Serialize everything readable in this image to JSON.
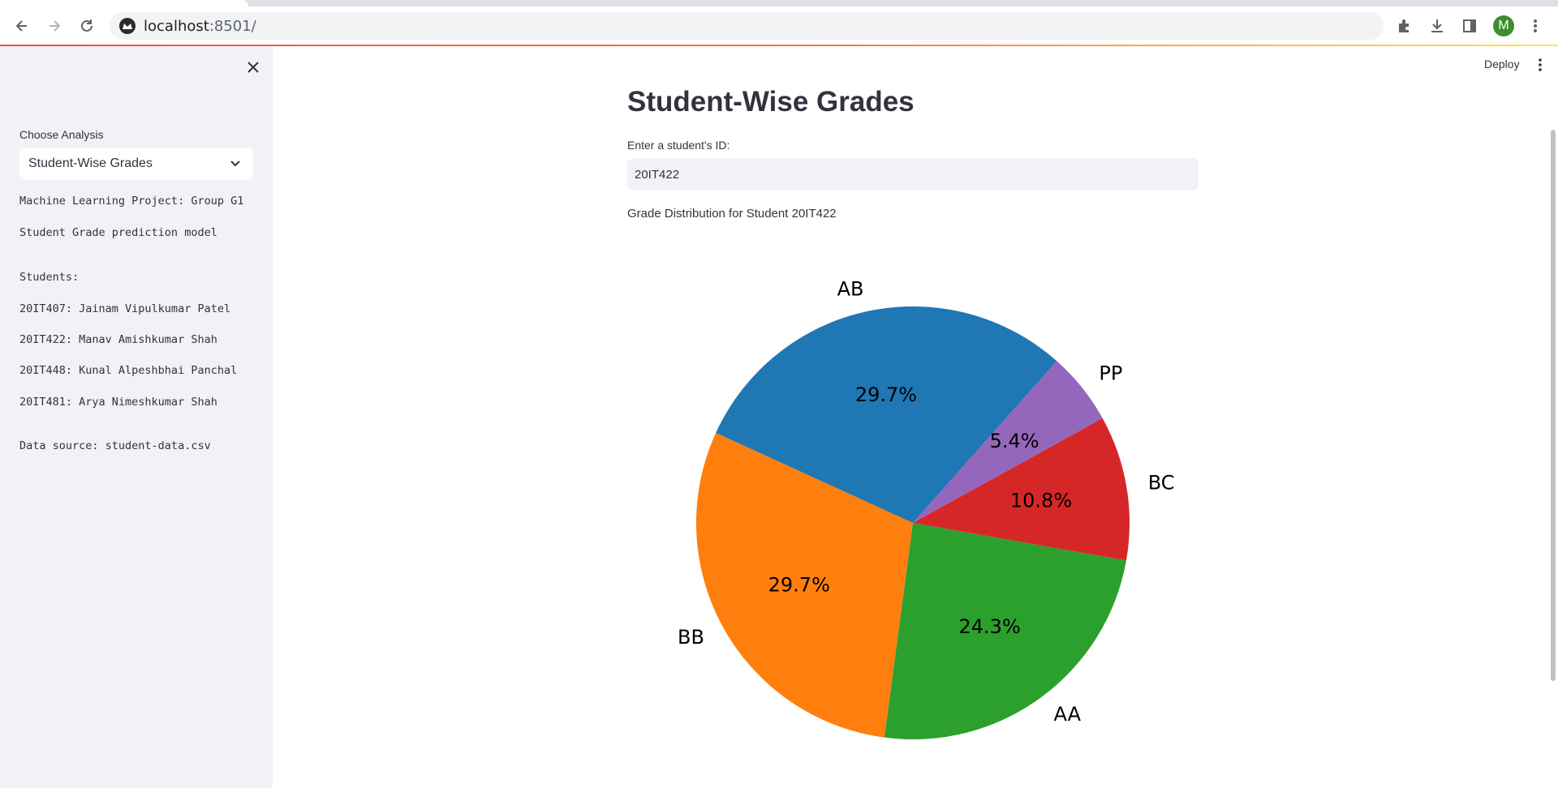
{
  "browser": {
    "url_host": "localhost",
    "url_port": ":8501/",
    "avatar_letter": "M"
  },
  "app": {
    "deploy_label": "Deploy"
  },
  "sidebar": {
    "select_label": "Choose Analysis",
    "select_value": "Student-Wise Grades",
    "lines": [
      "Machine Learning Project: Group G1",
      "Student Grade prediction model",
      "Students:",
      "20IT407: Jainam Vipulkumar Patel",
      "20IT422: Manav Amishkumar Shah",
      "20IT448: Kunal Alpeshbhai Panchal",
      "20IT481: Arya Nimeshkumar Shah",
      "Data source: student-data.csv"
    ]
  },
  "main": {
    "title": "Student-Wise Grades",
    "input_label": "Enter a student's ID:",
    "input_value": "20IT422",
    "caption": "Grade Distribution for Student 20IT422"
  },
  "colors": {
    "accent": "#ff4b4b",
    "sidebar_bg": "#f0f2f6",
    "text": "#31333f"
  },
  "chart_data": {
    "type": "pie",
    "title": "",
    "slices": [
      {
        "label": "AA",
        "value": 24.3,
        "pct_label": "24.3%",
        "color": "#2ca02c"
      },
      {
        "label": "BB",
        "value": 29.7,
        "pct_label": "29.7%",
        "color": "#ff7f0e"
      },
      {
        "label": "AB",
        "value": 29.7,
        "pct_label": "29.7%",
        "color": "#1f77b4"
      },
      {
        "label": "PP",
        "value": 5.4,
        "pct_label": "5.4%",
        "color": "#9467bd"
      },
      {
        "label": "BC",
        "value": 10.8,
        "pct_label": "10.8%",
        "color": "#d62728"
      }
    ]
  }
}
